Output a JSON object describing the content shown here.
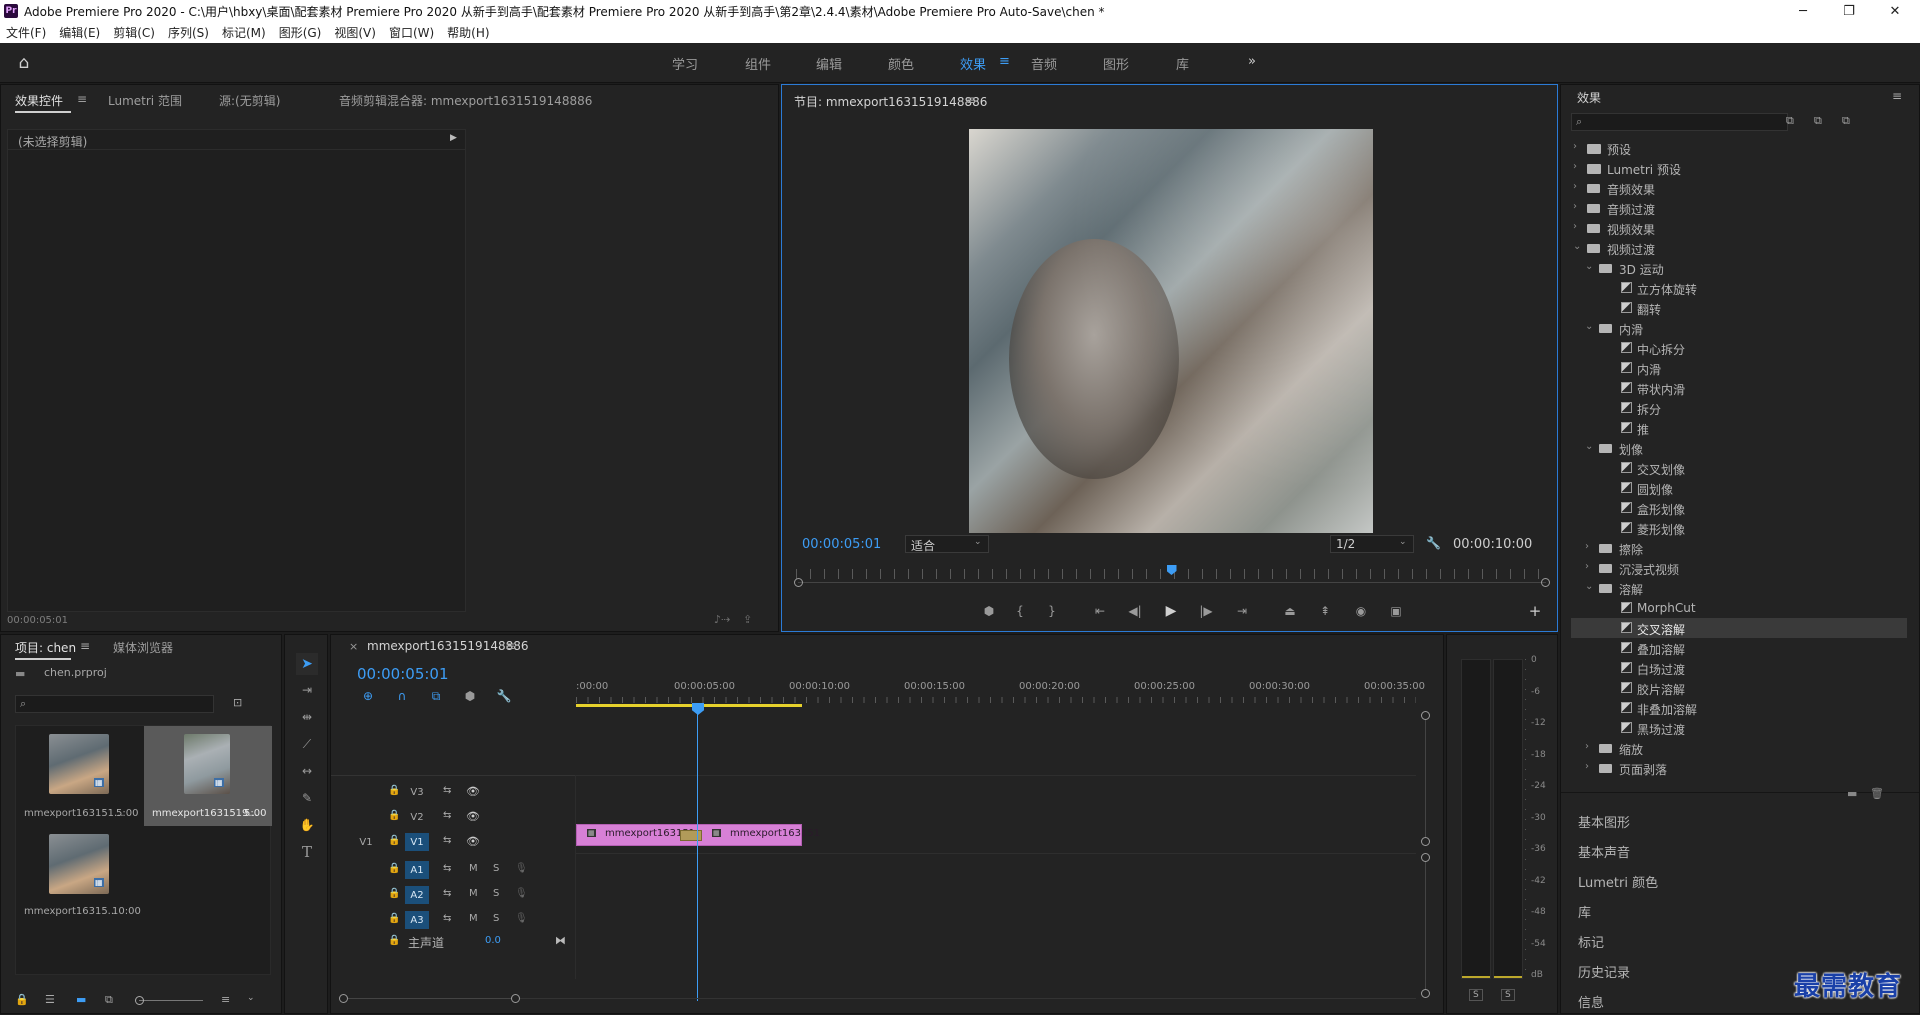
{
  "window": {
    "title": "Adobe Premiere Pro 2020 - C:\\用户\\hbxy\\桌面\\配套素材 Premiere Pro 2020 从新手到高手\\配套素材 Premiere Pro 2020 从新手到高手\\第2章\\2.4.4\\素材\\Adobe Premiere Pro Auto-Save\\chen *",
    "logo": "Pr"
  },
  "menu": [
    "文件(F)",
    "编辑(E)",
    "剪辑(C)",
    "序列(S)",
    "标记(M)",
    "图形(G)",
    "视图(V)",
    "窗口(W)",
    "帮助(H)"
  ],
  "workspaces": [
    "学习",
    "组件",
    "编辑",
    "颜色",
    "效果",
    "音频",
    "图形",
    "库"
  ],
  "workspace_active": "效果",
  "source_panel": {
    "tabs": [
      "效果控件",
      "Lumetri 范围",
      "源:(无剪辑)",
      "音频剪辑混合器: mmexport1631519148886"
    ],
    "clip_label": "(未选择剪辑)",
    "timecode": "00:00:05:01"
  },
  "program_panel": {
    "title": "节目: mmexport1631519148886",
    "timecode": "00:00:05:01",
    "fit": "适合",
    "resolution": "1/2",
    "duration": "00:00:10:00",
    "playhead_fraction": 0.5
  },
  "effects_panel": {
    "title": "效果",
    "tree": [
      {
        "label": "预设",
        "type": "folder-special",
        "level": 0,
        "open": false
      },
      {
        "label": "Lumetri 预设",
        "type": "folder-special",
        "level": 0,
        "open": false
      },
      {
        "label": "音频效果",
        "type": "folder",
        "level": 0,
        "open": false
      },
      {
        "label": "音频过渡",
        "type": "folder",
        "level": 0,
        "open": false
      },
      {
        "label": "视频效果",
        "type": "folder",
        "level": 0,
        "open": false
      },
      {
        "label": "视频过渡",
        "type": "folder",
        "level": 0,
        "open": true
      },
      {
        "label": "3D 运动",
        "type": "folder",
        "level": 1,
        "open": true
      },
      {
        "label": "立方体旋转",
        "type": "effect",
        "level": 2
      },
      {
        "label": "翻转",
        "type": "effect",
        "level": 2
      },
      {
        "label": "内滑",
        "type": "folder",
        "level": 1,
        "open": true
      },
      {
        "label": "中心拆分",
        "type": "effect",
        "level": 2
      },
      {
        "label": "内滑",
        "type": "effect",
        "level": 2
      },
      {
        "label": "带状内滑",
        "type": "effect",
        "level": 2
      },
      {
        "label": "拆分",
        "type": "effect",
        "level": 2
      },
      {
        "label": "推",
        "type": "effect",
        "level": 2
      },
      {
        "label": "划像",
        "type": "folder",
        "level": 1,
        "open": true
      },
      {
        "label": "交叉划像",
        "type": "effect",
        "level": 2
      },
      {
        "label": "圆划像",
        "type": "effect",
        "level": 2
      },
      {
        "label": "盒形划像",
        "type": "effect",
        "level": 2
      },
      {
        "label": "菱形划像",
        "type": "effect",
        "level": 2
      },
      {
        "label": "擦除",
        "type": "folder",
        "level": 1,
        "open": false
      },
      {
        "label": "沉浸式视频",
        "type": "folder",
        "level": 1,
        "open": false
      },
      {
        "label": "溶解",
        "type": "folder",
        "level": 1,
        "open": true
      },
      {
        "label": "MorphCut",
        "type": "effect",
        "level": 2
      },
      {
        "label": "交叉溶解",
        "type": "effect",
        "level": 2,
        "selected": true
      },
      {
        "label": "叠加溶解",
        "type": "effect",
        "level": 2
      },
      {
        "label": "白场过渡",
        "type": "effect",
        "level": 2
      },
      {
        "label": "胶片溶解",
        "type": "effect",
        "level": 2
      },
      {
        "label": "非叠加溶解",
        "type": "effect",
        "level": 2
      },
      {
        "label": "黑场过渡",
        "type": "effect",
        "level": 2
      },
      {
        "label": "缩放",
        "type": "folder",
        "level": 1,
        "open": false
      },
      {
        "label": "页面剥落",
        "type": "folder",
        "level": 1,
        "open": false
      }
    ],
    "side_panels": [
      "基本图形",
      "基本声音",
      "Lumetri 颜色",
      "库",
      "标记",
      "历史记录",
      "信息"
    ]
  },
  "project_panel": {
    "tabs": [
      "项目: chen",
      "媒体浏览器"
    ],
    "project_file": "chen.prproj",
    "items": [
      {
        "name": "mmexport163151...",
        "duration": "5:00"
      },
      {
        "name": "mmexport1631519...",
        "duration": "5:00"
      },
      {
        "name": "mmexport16315...",
        "duration": "10:00"
      }
    ]
  },
  "timeline": {
    "tab": "mmexport1631519148886",
    "timecode": "00:00:05:01",
    "ruler": [
      ":00:00",
      "00:00:05:00",
      "00:00:10:00",
      "00:00:15:00",
      "00:00:20:00",
      "00:00:25:00",
      "00:00:30:00",
      "00:00:35:00"
    ],
    "video_tracks": [
      "V3",
      "V2",
      "V1"
    ],
    "audio_tracks": [
      "A1",
      "A2",
      "A3"
    ],
    "source_patch": "V1",
    "master_label": "主声道",
    "master_value": "0.0",
    "clip_names": [
      "mmexport163151",
      "mmexport163151"
    ],
    "mute_label": "M",
    "solo_label": "S"
  },
  "meter": {
    "ticks": [
      "0",
      "-6",
      "-12",
      "-18",
      "-24",
      "-30",
      "-36",
      "-42",
      "-48",
      "-54",
      "dB"
    ],
    "solo": [
      "S",
      "S"
    ]
  },
  "watermark": "最需教育"
}
